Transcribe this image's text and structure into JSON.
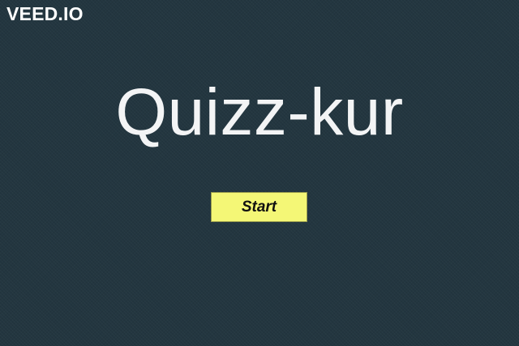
{
  "watermark": {
    "text": "VEED.IO"
  },
  "quiz": {
    "title": "Quizz-kur",
    "start_label": "Start"
  },
  "colors": {
    "background": "#233640",
    "title_text": "#f3f4f5",
    "button_background": "#f4f776",
    "button_text": "#111111"
  }
}
